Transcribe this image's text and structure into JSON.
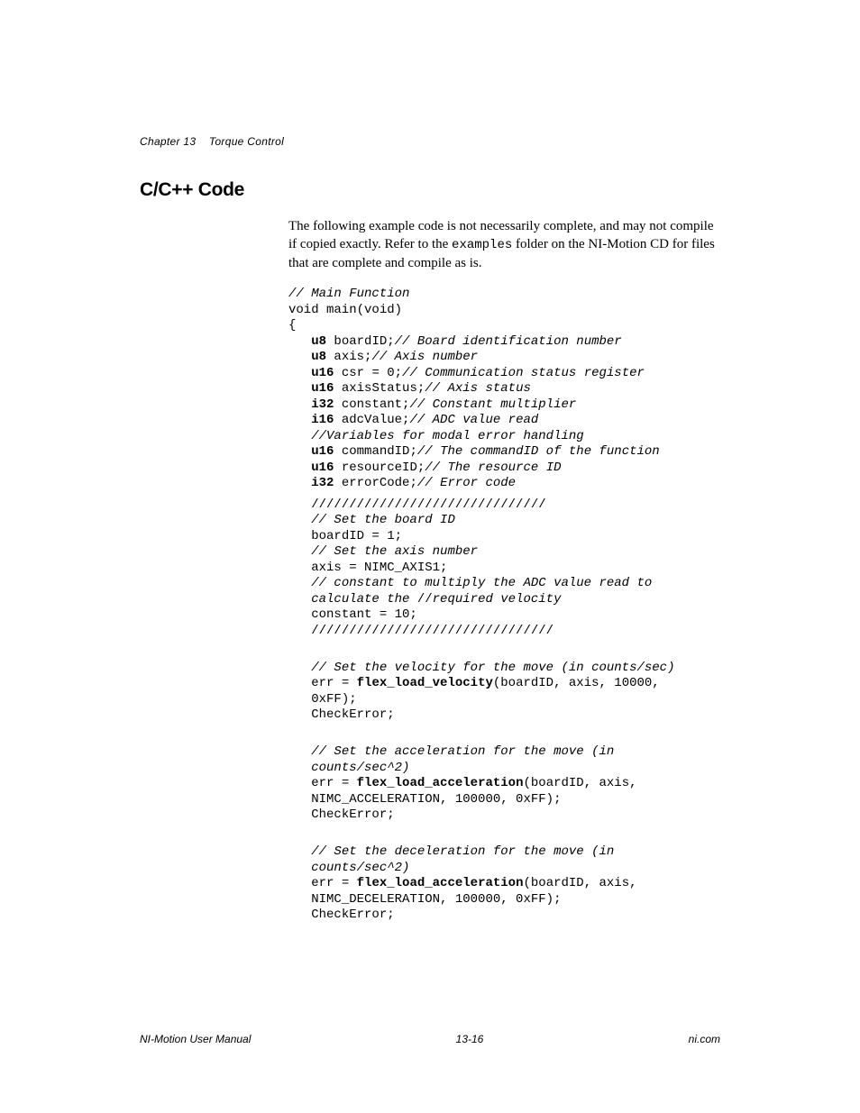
{
  "header": {
    "chapter": "Chapter 13",
    "title": "Torque Control"
  },
  "heading": "C/C++ Code",
  "intro": {
    "part1": "The following example code is not necessarily complete, and may not compile if copied exactly. Refer to the ",
    "mono": "examples",
    "part2": " folder on the NI-Motion CD for files that are complete and compile as is."
  },
  "code": {
    "l1": "// Main Function",
    "l2": "void main(void)",
    "l3": "{",
    "l4a": "u8",
    "l4b": " boardID;",
    "l4c": "// Board identification number",
    "l5a": "u8",
    "l5b": " axis;",
    "l5c": "// Axis number",
    "l6a": "u16",
    "l6b": " csr = 0;",
    "l6c": "// Communication status register",
    "l7a": "u16",
    "l7b": " axisStatus;",
    "l7c": "// Axis status",
    "l8a": "i32",
    "l8b": " constant;",
    "l8c": "// Constant multiplier",
    "l9a": "i16",
    "l9b": " adcValue;",
    "l9c": "// ADC value read",
    "l10": "//Variables for modal error handling",
    "l11a": "u16",
    "l11b": " commandID;",
    "l11c": "// The commandID of the function",
    "l12a": "u16",
    "l12b": " resourceID;",
    "l12c": "// The resource ID",
    "l13a": "i32",
    "l13b": " errorCode;",
    "l13c": "// Error code",
    "l14": "///////////////////////////////",
    "l15": "// Set the board ID",
    "l16": "boardID = 1;",
    "l17": "// Set the axis number",
    "l18": "axis = NIMC_AXIS1;",
    "l19": "// constant to multiply the ADC value read to ",
    "l20a": "calculate the ",
    "l20b": "//",
    "l20c": "required velocity",
    "l21": "constant = 10;",
    "l22": "////////////////////////////////",
    "l23": "// Set the velocity for the move (in counts/sec)",
    "l24a": "err = ",
    "l24b": "flex_load_velocity",
    "l24c": "(boardID, axis, 10000, ",
    "l25": "0xFF);",
    "l26": "CheckError;",
    "l27": "// Set the acceleration for the move (in ",
    "l28": "counts/sec^2)",
    "l29a": "err = ",
    "l29b": "flex_load_acceleration",
    "l29c": "(boardID, axis, ",
    "l30": "NIMC_ACCELERATION, 100000, 0xFF);",
    "l31": "CheckError;",
    "l32": "// Set the deceleration for the move (in ",
    "l33": "counts/sec^2)",
    "l34a": "err = ",
    "l34b": "flex_load_acceleration",
    "l34c": "(boardID, axis, ",
    "l35": "NIMC_DECELERATION, 100000, 0xFF);",
    "l36": "CheckError;"
  },
  "footer": {
    "left": "NI-Motion User Manual",
    "center": "13-16",
    "right": "ni.com"
  }
}
